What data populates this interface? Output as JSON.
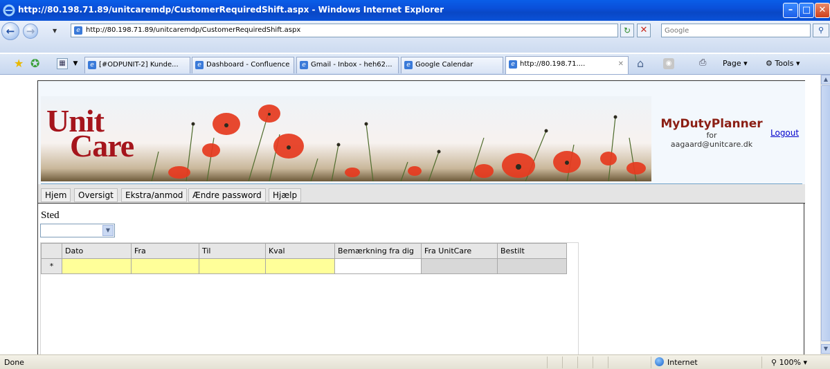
{
  "window": {
    "title": "http://80.198.71.89/unitcaremdp/CustomerRequiredShift.aspx - Windows Internet Explorer",
    "min_glyph": "–",
    "max_glyph": "□",
    "close_glyph": "✕"
  },
  "address": {
    "url": "http://80.198.71.89/unitcaremdp/CustomerRequiredShift.aspx",
    "search_placeholder": "Google"
  },
  "tabs": [
    {
      "label": "[#ODPUNIT-2] Kunde..."
    },
    {
      "label": "Dashboard - Confluence"
    },
    {
      "label": "Gmail - Inbox - heh62..."
    },
    {
      "label": "Google Calendar"
    },
    {
      "label": "http://80.198.71....",
      "active": true
    }
  ],
  "toolbar": {
    "page_label": "Page",
    "tools_label": "Tools"
  },
  "app": {
    "logo_line1": "Unit",
    "logo_line2": "Care",
    "brand": "MyDutyPlanner",
    "for_label": "for",
    "user_email": "aagaard@unitcare.dk",
    "logout": "Logout",
    "menu": [
      "Hjem",
      "Oversigt",
      "Ekstra/anmod",
      "Ændre password",
      "Hjælp"
    ],
    "sted_label": "Sted",
    "sted_value": ""
  },
  "grid": {
    "columns": [
      "Dato",
      "Fra",
      "Til",
      "Kval",
      "Bemærkning fra dig",
      "Fra UnitCare",
      "Bestilt"
    ],
    "new_row_marker": "*"
  },
  "status": {
    "text": "Done",
    "zone": "Internet",
    "zoom": "100%"
  },
  "colors": {
    "titlebar": "#0a52d8",
    "brand": "#8b1f14",
    "logo": "#a5151c",
    "input_yellow": "#ffff99"
  }
}
